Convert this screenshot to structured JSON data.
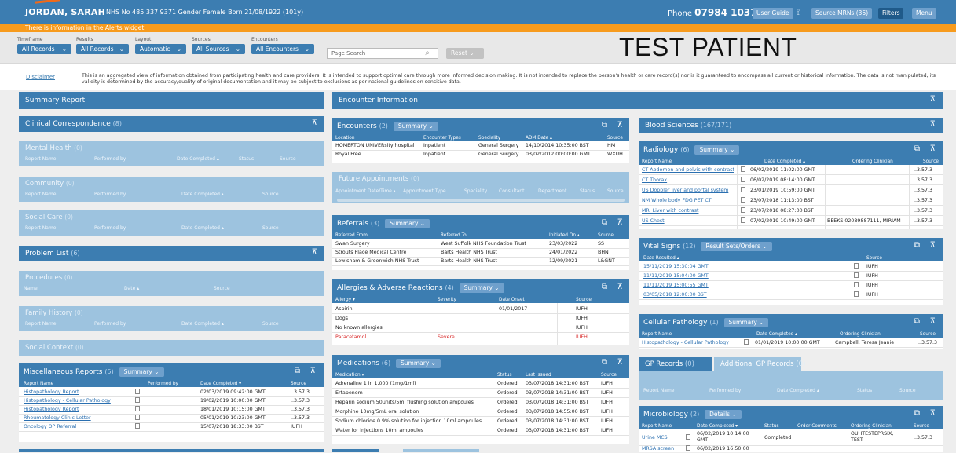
{
  "header": {
    "patient_name": "JORDAN, SARAH",
    "meta": "NHS No 485 337 9371  Gender Female  Born 21/08/1922 (101y)",
    "phone_label": "Phone",
    "phone": "07984 103736",
    "buttons": {
      "user_guide": "User Guide",
      "source_mrns": "Source MRNs (36)",
      "filters": "Filters",
      "menu": "Menu"
    },
    "alert": "There is information in the Alerts widget",
    "watermark": "TEST PATIENT"
  },
  "filters": {
    "timeframe": {
      "label": "Timeframe",
      "value": "All Records"
    },
    "results": {
      "label": "Results",
      "value": "All Records"
    },
    "layout": {
      "label": "Layout",
      "value": "Automatic"
    },
    "sources": {
      "label": "Sources",
      "value": "All Sources"
    },
    "encounters": {
      "label": "Encounters",
      "value": "All Encounters"
    },
    "search_placeholder": "Page Search",
    "reset": "Reset"
  },
  "disclaimer": {
    "link": "Disclaimer",
    "text": "This is an aggregated view of information obtained from participating health and care providers. It is intended to support optimal care through more informed decision making. It is not intended to replace the person's health or care record(s) nor is it guaranteed to encompass all current or historical information. The data is not manipulated, its validity is determined by the accuracy/quality of original documentation and it may be subject to exclusions as per national guidelines on sensitive data."
  },
  "left": {
    "summary_report": "Summary Report",
    "clinical_correspondence": {
      "title": "Clinical Correspondence",
      "count": "(8)"
    },
    "mental_health": {
      "title": "Mental Health",
      "count": "(0)",
      "cols": [
        "Report Name",
        "Performed by",
        "Date Completed ▴",
        "Status",
        "Source"
      ]
    },
    "community": {
      "title": "Community",
      "count": "(0)",
      "cols": [
        "Report Name",
        "Performed by",
        "Date Completed ▴",
        "Source"
      ]
    },
    "social_care": {
      "title": "Social Care",
      "count": "(0)",
      "cols": [
        "Report Name",
        "Performed by",
        "Date Completed ▴",
        "Source"
      ]
    },
    "problem_list": {
      "title": "Problem List",
      "count": "(6)"
    },
    "procedures": {
      "title": "Procedures",
      "count": "(0)",
      "cols": [
        "Name",
        "Date ▴",
        "Source"
      ]
    },
    "family_history": {
      "title": "Family History",
      "count": "(0)",
      "cols": [
        "Report Name",
        "Performed by",
        "Date Completed ▴",
        "Source"
      ]
    },
    "social_context": {
      "title": "Social Context",
      "count": "(0)"
    },
    "misc": {
      "title": "Miscellaneous Reports",
      "count": "(5)",
      "view": "Summary",
      "cols": [
        "Report Name",
        "Performed by",
        "Date Completed ▾",
        "Source"
      ],
      "rows": [
        [
          "Histopathology Report",
          "02/03/2019 09:42:00 GMT",
          "..3.57.3"
        ],
        [
          "Histopathology - Cellular Pathology",
          "19/02/2019 10:00:00 GMT",
          "..3.57.3"
        ],
        [
          "Histopathology Report",
          "18/01/2019 10:15:00 GMT",
          "..3.57.3"
        ],
        [
          "Rheumatology Clinic Letter",
          "05/01/2019 10:23:00 GMT",
          "..3.57.3"
        ],
        [
          "Oncology OP Referral",
          "15/07/2018 18:33:00 BST",
          "IUFH"
        ]
      ]
    }
  },
  "middle": {
    "encounter_info": "Encounter Information",
    "encounters": {
      "title": "Encounters",
      "count": "(2)",
      "view": "Summary",
      "cols": [
        "Location",
        "Encounter Types",
        "Speciality",
        "ADM Date ▴",
        "Source"
      ],
      "rows": [
        [
          "HOMERTON UNIVERsity hospital",
          "Inpatient",
          "General Surgery",
          "14/10/2014 10:35:00 BST",
          "HM"
        ],
        [
          "Royal Free",
          "Inpatient",
          "General Surgery",
          "03/02/2012 00:00:00 GMT",
          "WXUH"
        ]
      ]
    },
    "future": {
      "title": "Future Appointments",
      "count": "(0)",
      "cols": [
        "Appointment Date/Time ▴",
        "Appointment Type",
        "Speciality",
        "Consultant",
        "Department",
        "Status",
        "Source"
      ]
    },
    "referrals": {
      "title": "Referrals",
      "count": "(3)",
      "view": "Summary",
      "cols": [
        "Referred From",
        "Referred To",
        "Initiated On ▴",
        "Source"
      ],
      "rows": [
        [
          "Swan Surgery",
          "West Suffolk NHS Foundation Trust",
          "23/03/2022",
          "SS"
        ],
        [
          "Strouts Place Medical Centre",
          "Barts Health NHS Trust",
          "24/01/2022",
          "BHNT"
        ],
        [
          "Lewisham & Greenwich NHS Trust",
          "Barts Health NHS Trust",
          "12/09/2021",
          "L&GNT"
        ]
      ]
    },
    "allergies": {
      "title": "Allergies & Adverse Reactions",
      "count": "(4)",
      "view": "Summary",
      "cols": [
        "Allergy ▾",
        "Severity",
        "Date Onset",
        "Source"
      ],
      "rows": [
        [
          "Aspirin",
          "",
          "01/01/2017",
          "IUFH"
        ],
        [
          "Dogs",
          "",
          "",
          "IUFH"
        ],
        [
          "No known allergies",
          "",
          "",
          "IUFH"
        ],
        [
          "Paracetamol",
          "Severe",
          "",
          "IUFH"
        ]
      ]
    },
    "medications": {
      "title": "Medications",
      "count": "(6)",
      "view": "Summary",
      "cols": [
        "Medication ▾",
        "Status",
        "Last Issued",
        "Source"
      ],
      "rows": [
        [
          "Adrenaline 1 in 1,000 (1mg/1ml)",
          "Ordered",
          "03/07/2018 14:31:00 BST",
          "IUFH"
        ],
        [
          "Ertapenem",
          "Ordered",
          "03/07/2018 14:31:00 BST",
          "IUFH"
        ],
        [
          "Heparin sodium 50units/5ml flushing solution ampoules",
          "Ordered",
          "03/07/2018 14:31:00 BST",
          "IUFH"
        ],
        [
          "Morphine 10mg/5mL oral solution",
          "Ordered",
          "03/07/2018 14:55:00 BST",
          "IUFH"
        ],
        [
          "Sodium chloride 0.9% solution for injection 10ml ampoules",
          "Ordered",
          "03/07/2018 14:31:00 BST",
          "IUFH"
        ],
        [
          "Water for injections 10ml ampoules",
          "Ordered",
          "03/07/2018 14:31:00 BST",
          "IUFH"
        ]
      ]
    }
  },
  "right": {
    "blood_sciences": {
      "title": "Blood Sciences",
      "count": "(167/171)"
    },
    "radiology": {
      "title": "Radiology",
      "count": "(6)",
      "view": "Summary",
      "cols": [
        "Report Name",
        "Date Completed ▴",
        "Ordering Clinician",
        "Source"
      ],
      "rows": [
        [
          "CT Abdomen and pelvis with contrast",
          "06/02/2019 11:02:00 GMT",
          "",
          "..3.57.3"
        ],
        [
          "CT Thorax",
          "06/02/2019 08:14:00 GMT",
          "",
          "..3.57.3"
        ],
        [
          "US Doppler liver and portal system",
          "23/01/2019 10:59:00 GMT",
          "",
          "..3.57.3"
        ],
        [
          "NM Whole body FDG PET CT",
          "23/07/2018 11:13:00 BST",
          "",
          "..3.57.3"
        ],
        [
          "MRI Liver with contrast",
          "23/07/2018 08:27:00 BST",
          "",
          "..3.57.3"
        ],
        [
          "US Chest",
          "07/02/2019 10:49:00 GMT",
          "BEEKS 02089887111, MIRIAM",
          "..3.57.3"
        ]
      ]
    },
    "vitals": {
      "title": "Vital Signs",
      "count": "(12)",
      "view": "Result Sets/Orders",
      "cols": [
        "Date Resulted ▴",
        "Source"
      ],
      "rows": [
        [
          "15/11/2019 15:30:04 GMT",
          "IUFH"
        ],
        [
          "11/11/2019 15:04:00 GMT",
          "IUFH"
        ],
        [
          "11/11/2019 15:00:55 GMT",
          "IUFH"
        ],
        [
          "03/05/2018 12:00:00 BST",
          "IUFH"
        ]
      ]
    },
    "cellular": {
      "title": "Cellular Pathology",
      "count": "(1)",
      "view": "Summary",
      "cols": [
        "Report Name",
        "Date Completed ▴",
        "Ordering Clinician",
        "Source"
      ],
      "rows": [
        [
          "Histopathology - Cellular Pathology",
          "01/01/2019 10:00:00 GMT",
          "Campbell, Teresa Jeanie",
          "..3.57.3"
        ]
      ]
    },
    "gp": {
      "tab1": "GP Records",
      "tab1_count": "(0)",
      "tab2": "Additional GP Records",
      "tab2_count": "(0)",
      "cols": [
        "Report Name",
        "Performed by",
        "Date Completed ▴",
        "Status",
        "Source"
      ]
    },
    "micro": {
      "title": "Microbiology",
      "count": "(2)",
      "view": "Details",
      "cols": [
        "Report Name",
        "Date Completed ▾",
        "Status",
        "Order Comments",
        "Ordering Clinician",
        "Source"
      ],
      "row1": {
        "name": "Urine MCS",
        "date": "06/02/2019 10:14:00",
        "date2": "GMT",
        "status": "Completed",
        "clin": "OUHTESTEPRSIX,",
        "clin2": "TEST",
        "src": "..3.57.3"
      },
      "row2": {
        "name": "MRSA screen",
        "date": "06/02/2019 16:50:00"
      }
    }
  }
}
